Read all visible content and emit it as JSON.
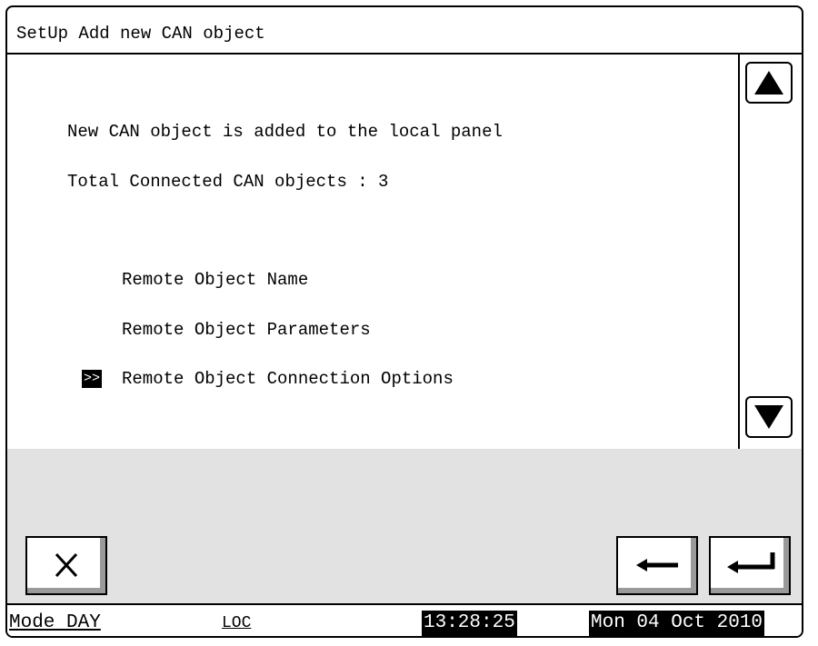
{
  "window": {
    "title": "SetUp Add new CAN object"
  },
  "content": {
    "message": "New CAN object is added to the local panel",
    "total_label": "Total Connected CAN objects : 3",
    "menu_items": [
      {
        "label": "Remote Object Name",
        "selected": false
      },
      {
        "label": "Remote Object Parameters",
        "selected": false
      },
      {
        "label": "Remote Object Connection Options",
        "selected": true
      }
    ],
    "cursor_marker": ">>"
  },
  "icons": {
    "scroll_up": "triangle-up-icon",
    "scroll_down": "triangle-down-icon",
    "cancel": "x-icon",
    "back": "arrow-left-icon",
    "enter": "enter-return-icon"
  },
  "status": {
    "mode": "Mode DAY",
    "location": "LOC",
    "time": "13:28:25",
    "date": "Mon 04 Oct 2010"
  },
  "colors": {
    "background": "#ffffff",
    "footer_gray": "#e2e2e2",
    "inverse_bg": "#000000",
    "inverse_fg": "#ffffff"
  }
}
